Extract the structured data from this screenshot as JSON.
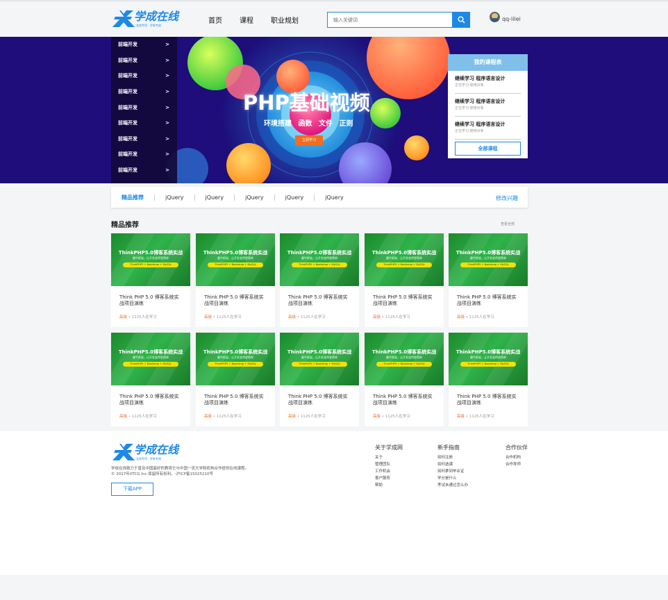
{
  "header": {
    "logo_text": "学成在线",
    "logo_slogan": "北成专用 · 学有专成",
    "nav": [
      "首页",
      "课程",
      "职业规划"
    ],
    "search_placeholder": "输入关键词",
    "user_name": "qq-lilei"
  },
  "banner": {
    "categories": [
      "前端开发",
      "前端开发",
      "前端开发",
      "前端开发",
      "前端开发",
      "前端开发",
      "前端开发",
      "前端开发",
      "前端开发"
    ],
    "arrow": ">",
    "title": "PHP基础视频",
    "subtitle": "环境搭建 函数 文件 正则",
    "button": "立即学习",
    "course_panel": {
      "title": "我的课程表",
      "items": [
        {
          "title": "继续学习 程序语言设计",
          "sub": "正在学习-使用对象"
        },
        {
          "title": "继续学习 程序语言设计",
          "sub": "正在学习-使用对象"
        },
        {
          "title": "继续学习 程序语言设计",
          "sub": "正在学习-使用对象"
        }
      ],
      "button": "全部课程"
    }
  },
  "tags": {
    "items": [
      "精品推荐",
      "jQuery",
      "jQuery",
      "jQuery",
      "jQuery",
      "jQuery"
    ],
    "edit": "修改兴趣"
  },
  "section": {
    "title": "精品推荐",
    "more": "查看全部"
  },
  "course_card": {
    "thumb_title": "ThinkPHP5.0博客系统实战",
    "thumb_sub": "最牛框架，让开发变得更简单",
    "thumb_badge": "ThinkPHP5 + Bootstrap + MySQL",
    "name": "Think PHP 5.0 博客系统实战项目演练",
    "level": "高级",
    "learners": " • 1125人在学习"
  },
  "footer": {
    "logo_text": "学成在线",
    "logo_slogan": "北成专用 · 学有专成",
    "desc_line1": "学成在线致力于普及中国最好的教育它与中国一流大学和机构合作提供在线课程。",
    "desc_line2": "© 2017年XTCG Inc.保留所有权利。-沪ICP备15025210号",
    "app_button": "下载APP",
    "columns": [
      {
        "title": "关于学成网",
        "links": [
          "关于",
          "管理团队",
          "工作机会",
          "客户服务",
          "帮助"
        ]
      },
      {
        "title": "新手指南",
        "links": [
          "如何注册",
          "如何选课",
          "如何拿到毕业证",
          "学分是什么",
          "考试未通过怎么办"
        ]
      },
      {
        "title": "合作伙伴",
        "links": [
          "合作机构",
          "合作导师"
        ]
      }
    ]
  },
  "colors": {
    "brand_blue": "#1e88e5",
    "banner_bg": "#1e0d7a",
    "accent_orange": "#f06d22"
  }
}
